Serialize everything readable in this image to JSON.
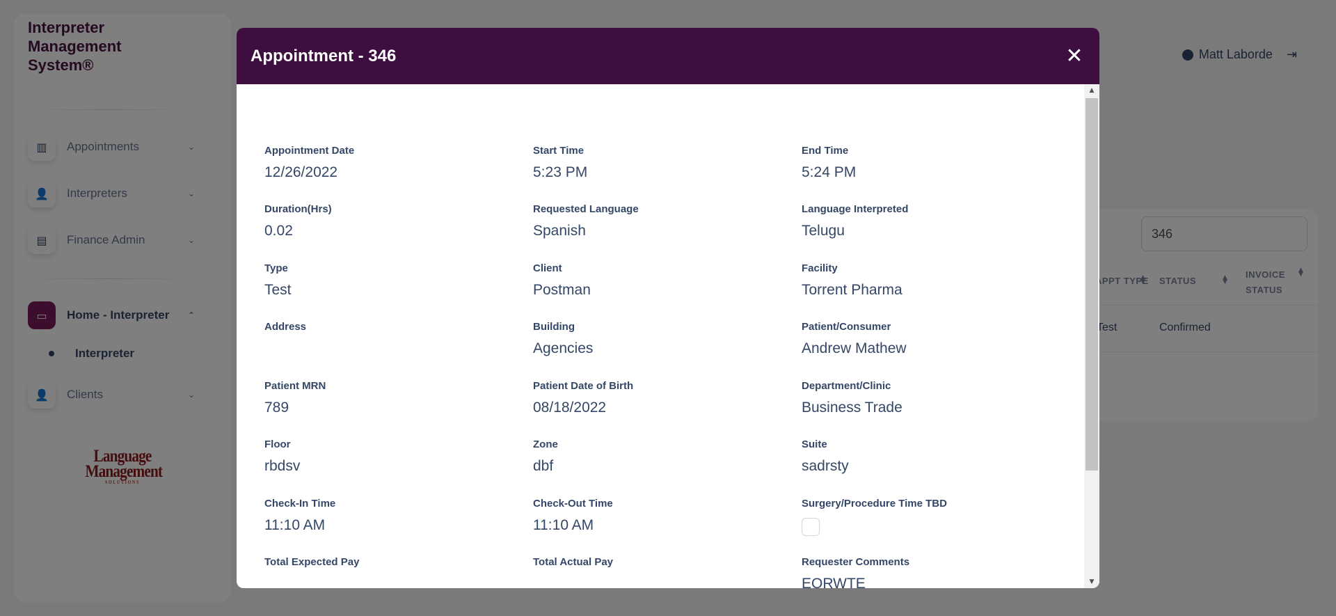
{
  "sidebar": {
    "brand": "Interpreter Management System®",
    "items": [
      {
        "label": "Appointments",
        "icon": "building-icon"
      },
      {
        "label": "Interpreters",
        "icon": "user-icon"
      },
      {
        "label": "Finance Admin",
        "icon": "document-icon"
      },
      {
        "label": "Home - Interpreter",
        "icon": "card-icon"
      },
      {
        "label": "Interpreter",
        "icon": "dot"
      },
      {
        "label": "Clients",
        "icon": "user-icon"
      }
    ],
    "logo_main": "Language Management",
    "logo_sub": "SOLUTIONS"
  },
  "header": {
    "user_name": "Matt Laborde"
  },
  "table": {
    "search_value": "346",
    "headers": [
      "APPT TYPE",
      "STATUS",
      "INVOICE STATUS"
    ],
    "row": {
      "appt_type": "Test",
      "status": "Confirmed",
      "invoice_status": ""
    }
  },
  "modal": {
    "title": "Appointment - 346",
    "fields": [
      {
        "label": "Appointment Date",
        "value": "12/26/2022"
      },
      {
        "label": "Start Time",
        "value": "5:23 PM"
      },
      {
        "label": "End Time",
        "value": "5:24 PM"
      },
      {
        "label": "Duration(Hrs)",
        "value": "0.02"
      },
      {
        "label": "Requested Language",
        "value": "Spanish"
      },
      {
        "label": "Language Interpreted",
        "value": "Telugu"
      },
      {
        "label": "Type",
        "value": "Test"
      },
      {
        "label": "Client",
        "value": "Postman"
      },
      {
        "label": "Facility",
        "value": "Torrent Pharma"
      },
      {
        "label": "Address",
        "value": ""
      },
      {
        "label": "Building",
        "value": "Agencies"
      },
      {
        "label": "Patient/Consumer",
        "value": "Andrew Mathew"
      },
      {
        "label": "Patient MRN",
        "value": "789"
      },
      {
        "label": "Patient Date of Birth",
        "value": "08/18/2022"
      },
      {
        "label": "Department/Clinic",
        "value": "Business Trade"
      },
      {
        "label": "Floor",
        "value": "rbdsv"
      },
      {
        "label": "Zone",
        "value": "dbf"
      },
      {
        "label": "Suite",
        "value": "sadrsty"
      },
      {
        "label": "Check-In Time",
        "value": "11:10 AM"
      },
      {
        "label": "Check-Out Time",
        "value": "11:10 AM"
      },
      {
        "label": "Surgery/Procedure Time TBD",
        "value": ""
      },
      {
        "label": "Total Expected Pay",
        "value": ""
      },
      {
        "label": "Total Actual Pay",
        "value": ""
      },
      {
        "label": "Requester Comments",
        "value": "EQRWTE"
      }
    ],
    "surgery_tbd_checked": false
  },
  "colors": {
    "modal_header": "#3f0e40",
    "brand": "#4a1340",
    "active_nav": "#7a1a5b"
  }
}
